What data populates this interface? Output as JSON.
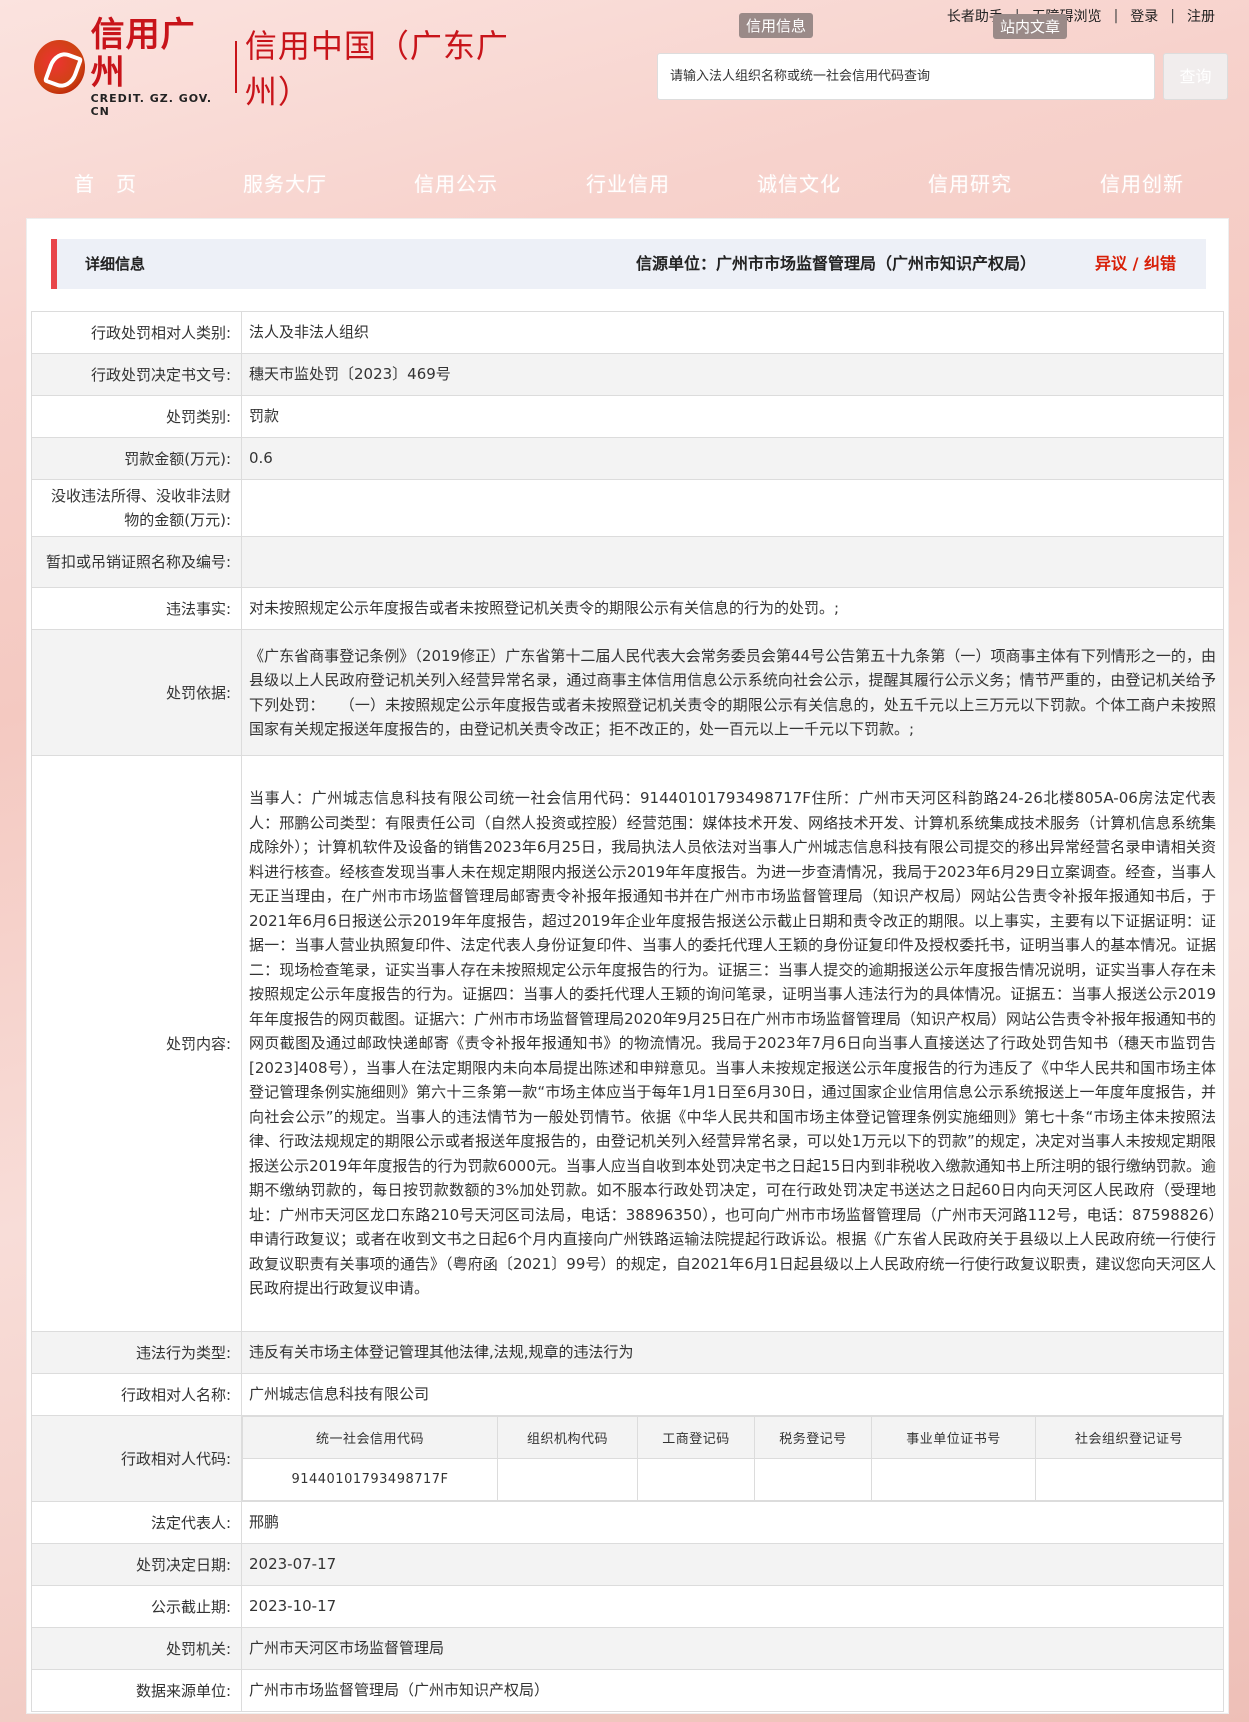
{
  "topbar": {
    "links": [
      "长者助手",
      "无障碍浏览",
      "登录",
      "注册"
    ],
    "float_tags": [
      "信用信息",
      "站内文章"
    ]
  },
  "logo": {
    "cn": "信用广州",
    "en": "CREDIT. GZ. GOV. CN",
    "sub": "信用中国（广东广州）"
  },
  "search": {
    "placeholder": "请输入法人组织名称或统一社会信用代码查询",
    "button": "查询"
  },
  "nav": [
    "首　页",
    "服务大厅",
    "信用公示",
    "行业信用",
    "诚信文化",
    "信用研究",
    "信用创新"
  ],
  "header": {
    "title": "详细信息",
    "source": "信源单位：广州市市场监督管理局（广州市知识产权局）",
    "dispute": "异议 / 纠错"
  },
  "rows": [
    {
      "key": "行政处罚相对人类别:",
      "value": "法人及非法人组织"
    },
    {
      "key": "行政处罚决定书文号:",
      "value": "穗天市监处罚〔2023〕469号"
    },
    {
      "key": "处罚类别:",
      "value": "罚款"
    },
    {
      "key": "罚款金额(万元):",
      "value": "0.6"
    },
    {
      "key": "没收违法所得、没收非法财物的金额(万元):",
      "value": ""
    },
    {
      "key": "暂扣或吊销证照名称及编号:",
      "value": ""
    },
    {
      "key": "违法事实:",
      "value": "对未按照规定公示年度报告或者未按照登记机关责令的期限公示有关信息的行为的处罚。;"
    },
    {
      "key": "处罚依据:",
      "value": "《广东省商事登记条例》（2019修正）广东省第十二届人民代表大会常务委员会第44号公告第五十九条第（一）项商事主体有下列情形之一的，由县级以上人民政府登记机关列入经营异常名录，通过商事主体信用信息公示系统向社会公示，提醒其履行公示义务；情节严重的，由登记机关给予下列处罚：　　（一）未按照规定公示年度报告或者未按照登记机关责令的期限公示有关信息的，处五千元以上三万元以下罚款。个体工商户未按照国家有关规定报送年度报告的，由登记机关责令改正；拒不改正的，处一百元以上一千元以下罚款。;"
    },
    {
      "key": "处罚内容:",
      "value": "当事人：广州城志信息科技有限公司统一社会信用代码：91440101793498717F住所：广州市天河区科韵路24-26北楼805A-06房法定代表人：邢鹏公司类型：有限责任公司（自然人投资或控股）经营范围：媒体技术开发、网络技术开发、计算机系统集成技术服务（计算机信息系统集成除外）；计算机软件及设备的销售2023年6月25日，我局执法人员依法对当事人广州城志信息科技有限公司提交的移出异常经营名录申请相关资料进行核查。经核查发现当事人未在规定期限内报送公示2019年年度报告。为进一步查清情况，我局于2023年6月29日立案调查。经查，当事人无正当理由，在广州市市场监督管理局邮寄责令补报年报通知书并在广州市市场监督管理局（知识产权局）网站公告责令补报年报通知书后，于2021年6月6日报送公示2019年年度报告，超过2019年企业年度报告报送公示截止日期和责令改正的期限。以上事实，主要有以下证据证明：证据一：当事人营业执照复印件、法定代表人身份证复印件、当事人的委托代理人王颖的身份证复印件及授权委托书，证明当事人的基本情况。证据二：现场检查笔录，证实当事人存在未按照规定公示年度报告的行为。证据三：当事人提交的逾期报送公示年度报告情况说明，证实当事人存在未按照规定公示年度报告的行为。证据四：当事人的委托代理人王颖的询问笔录，证明当事人违法行为的具体情况。证据五：当事人报送公示2019年年度报告的网页截图。证据六：广州市市场监督管理局2020年9月25日在广州市市场监督管理局（知识产权局）网站公告责令补报年报通知书的网页截图及通过邮政快递邮寄《责令补报年报通知书》的物流情况。我局于2023年7月6日向当事人直接送达了行政处罚告知书（穗天市监罚告[2023]408号），当事人在法定期限内未向本局提出陈述和申辩意见。当事人未按规定报送公示年度报告的行为违反了《中华人民共和国市场主体登记管理条例实施细则》第六十三条第一款“市场主体应当于每年1月1日至6月30日，通过国家企业信用信息公示系统报送上一年度年度报告，并向社会公示”的规定。当事人的违法情节为一般处罚情节。依据《中华人民共和国市场主体登记管理条例实施细则》第七十条“市场主体未按照法律、行政法规规定的期限公示或者报送年度报告的，由登记机关列入经营异常名录，可以处1万元以下的罚款”的规定，决定对当事人未按规定期限报送公示2019年年度报告的行为罚款6000元。当事人应当自收到本处罚决定书之日起15日内到非税收入缴款通知书上所注明的银行缴纳罚款。逾期不缴纳罚款的，每日按罚款数额的3%加处罚款。如不服本行政处罚决定，可在行政处罚决定书送达之日起60日内向天河区人民政府（受理地址：广州市天河区龙口东路210号天河区司法局，电话：38896350），也可向广州市市场监督管理局（广州市天河路112号，电话：87598826）申请行政复议；或者在收到文书之日起6个月内直接向广州铁路运输法院提起行政诉讼。根据《广东省人民政府关于县级以上人民政府统一行使行政复议职责有关事项的通告》（粤府函〔2021〕99号）的规定，自2021年6月1日起县级以上人民政府统一行使行政复议职责，建议您向天河区人民政府提出行政复议申请。"
    },
    {
      "key": "违法行为类型:",
      "value": "违反有关市场主体登记管理其他法律,法规,规章的违法行为"
    },
    {
      "key": "行政相对人名称:",
      "value": "广州城志信息科技有限公司"
    }
  ],
  "codes": {
    "key": "行政相对人代码:",
    "headers": [
      "统一社会信用代码",
      "组织机构代码",
      "工商登记码",
      "税务登记号",
      "事业单位证书号",
      "社会组织登记证号"
    ],
    "values": [
      "91440101793498717F",
      "",
      "",
      "",
      "",
      ""
    ]
  },
  "rows_after": [
    {
      "key": "法定代表人:",
      "value": "邢鹏"
    },
    {
      "key": "处罚决定日期:",
      "value": "2023-07-17"
    },
    {
      "key": "公示截止期:",
      "value": "2023-10-17"
    },
    {
      "key": "处罚机关:",
      "value": "广州市天河区市场监督管理局"
    },
    {
      "key": "数据来源单位:",
      "value": "广州市市场监督管理局（广州市知识产权局）"
    }
  ]
}
